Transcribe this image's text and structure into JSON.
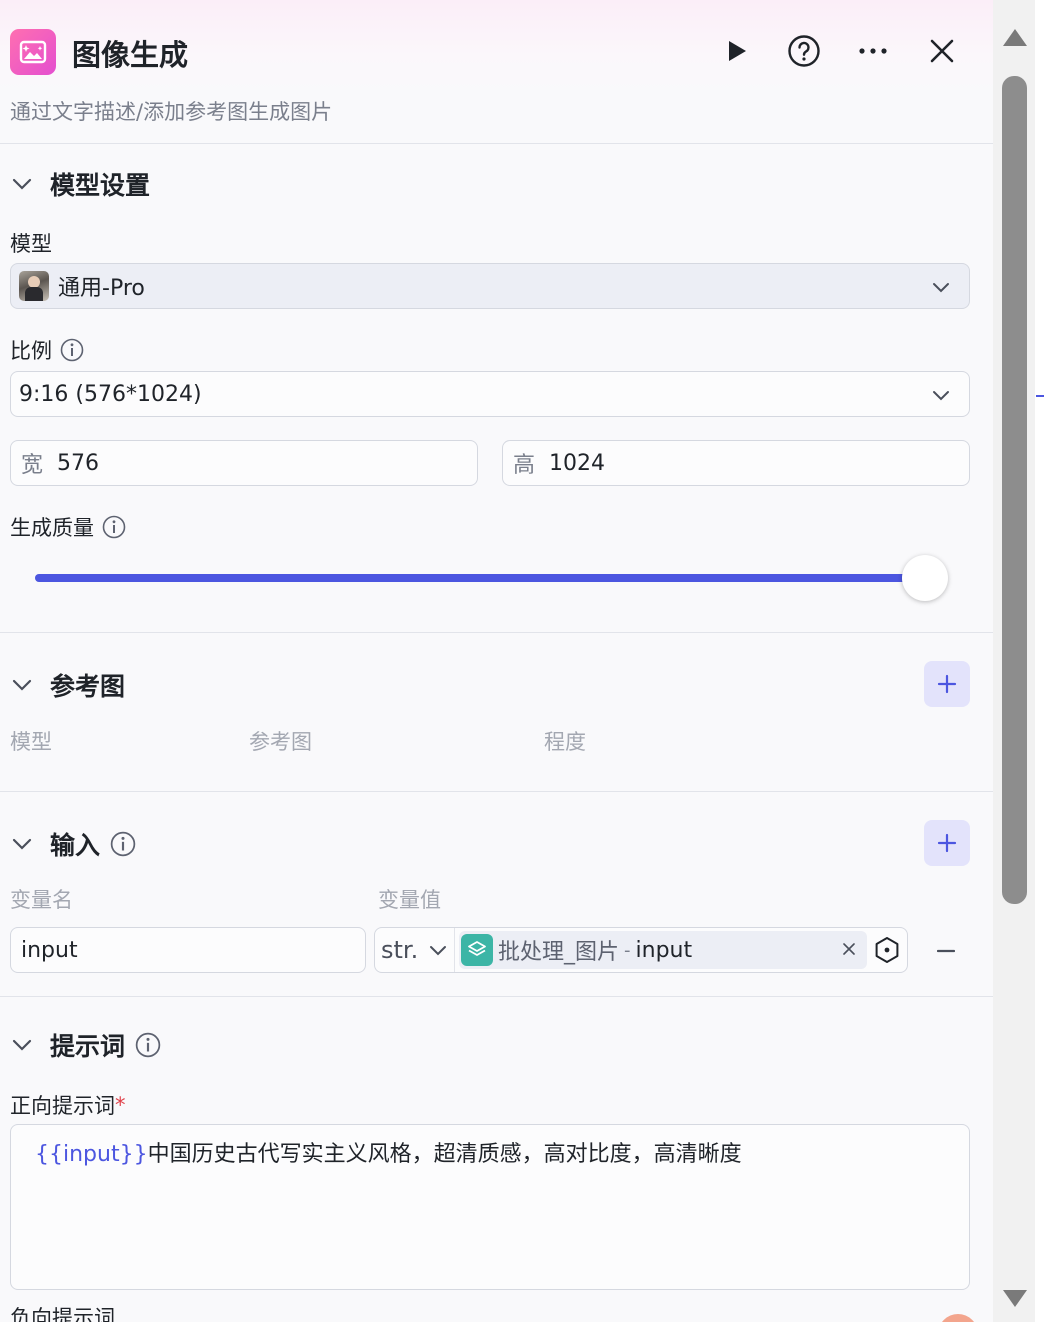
{
  "node": {
    "title": "图像生成",
    "description": "通过文字描述/添加参考图生成图片",
    "icon": "image-sparkle-icon",
    "actions": [
      "play-icon",
      "help-icon",
      "more-icon",
      "close-icon"
    ]
  },
  "model_settings": {
    "title": "模型设置",
    "model_label": "模型",
    "model_value": "通用-Pro",
    "ratio_label": "比例",
    "ratio_value": "9:16 (576*1024)",
    "width_prefix": "宽",
    "width_value": "576",
    "height_prefix": "高",
    "height_value": "1024",
    "quality_label": "生成质量",
    "quality_level": 1.0
  },
  "reference": {
    "title": "参考图",
    "columns": [
      "模型",
      "参考图",
      "程度"
    ]
  },
  "inputs": {
    "title": "输入",
    "columns": [
      "变量名",
      "变量值"
    ],
    "rows": [
      {
        "name": "input",
        "type": "str.",
        "ref_node": "批处理_图片",
        "ref_sep": "-",
        "ref_var": "input"
      }
    ]
  },
  "prompt": {
    "title": "提示词",
    "positive_label": "正向提示词",
    "required_mark": "*",
    "positive_var": "{{input}}",
    "positive_text": "中国历史古代写实主义风格，超清质感，高对比度，高清晰度",
    "negative_label": "负向提示词"
  },
  "colors": {
    "accent": "#4c56e0",
    "node_icon": "#e44fd0",
    "ref_icon": "#3cb5a6"
  }
}
